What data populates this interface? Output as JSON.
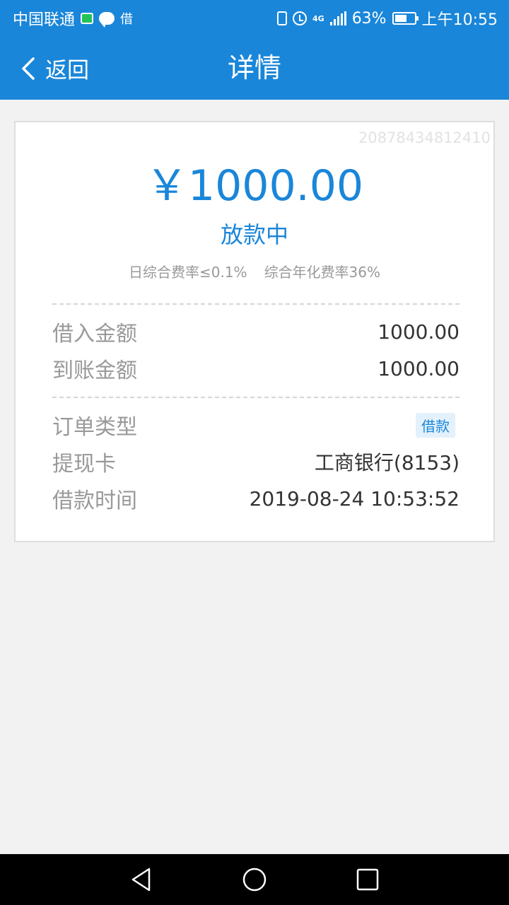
{
  "status_bar": {
    "carrier": "中国联通",
    "app_label": "借",
    "network": "4G",
    "battery": "63%",
    "battery_level": 0.63,
    "time": "上午10:55"
  },
  "nav": {
    "back_label": "返回",
    "title": "详情"
  },
  "detail": {
    "order_id": "20878434812410",
    "amount": "￥1000.00",
    "status": "放款中",
    "daily_rate": "日综合费率≤0.1%",
    "annual_rate": "综合年化费率36%",
    "borrow_amount_label": "借入金额",
    "borrow_amount_value": "1000.00",
    "received_amount_label": "到账金额",
    "received_amount_value": "1000.00",
    "order_type_label": "订单类型",
    "order_type_value": "借款",
    "card_label": "提现卡",
    "card_value": "工商银行(8153)",
    "time_label": "借款时间",
    "time_value": "2019-08-24 10:53:52"
  },
  "colors": {
    "accent": "#1a86d9",
    "label": "#999999",
    "value": "#333333"
  }
}
